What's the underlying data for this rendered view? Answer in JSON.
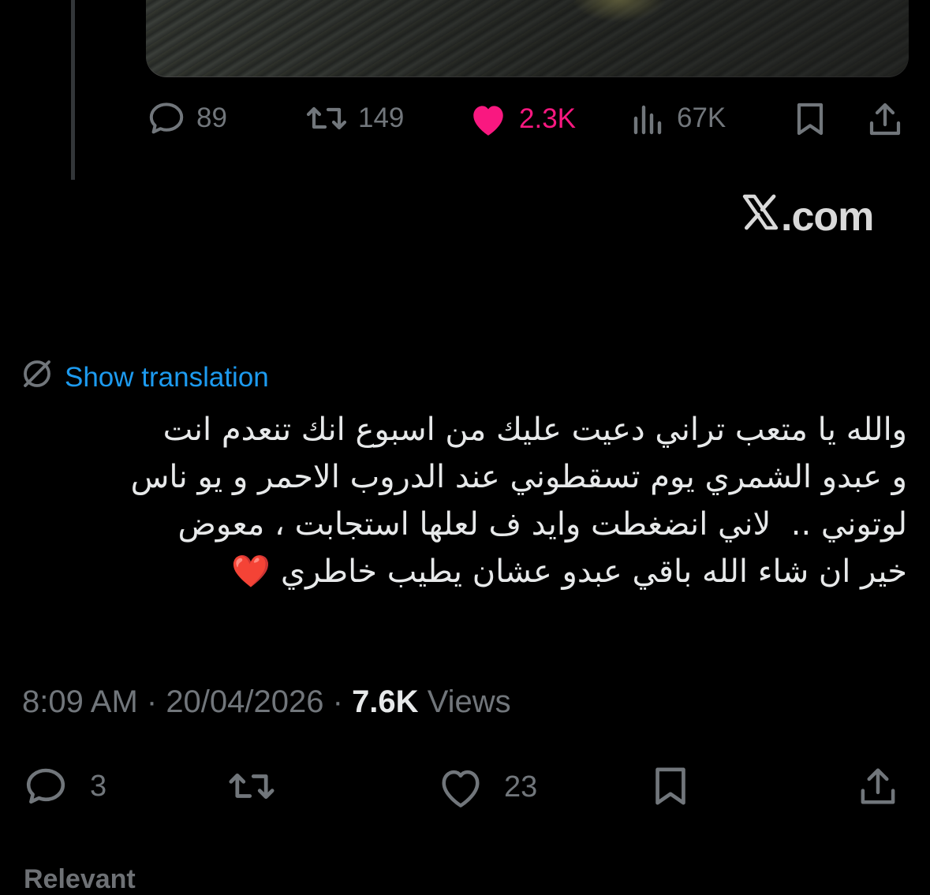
{
  "quoted_tweet": {
    "stats": {
      "replies": "89",
      "reposts": "149",
      "likes": "2.3K",
      "views": "67K"
    }
  },
  "watermark": {
    "text": ".com"
  },
  "translation": {
    "label": "Show translation"
  },
  "tweet": {
    "text_lines": [
      "والله يا متعب تراني دعيت عليك من اسبوع انك تنعدم انت",
      "و عبدو الشمري يوم تسقطوني عند الدروب الاحمر و يو ناس",
      "لوتوني ..  لاني انضغطت وايد ف لعلها استجابت ، معوض",
      "خير ان شاء الله باقي عبدو عشان يطيب خاطري"
    ],
    "emoji": "❤️"
  },
  "meta": {
    "time": "8:09 AM",
    "date": "20/04/2026",
    "views_count": "7.6K",
    "views_label": "Views"
  },
  "actions": {
    "replies": "3",
    "reposts": "",
    "likes": "23"
  },
  "footer": {
    "relevant": "Relevant"
  },
  "colors": {
    "background": "#000000",
    "text": "#e7e9ea",
    "muted": "#71767b",
    "link": "#1d9bf0",
    "like_active": "#f91880"
  }
}
